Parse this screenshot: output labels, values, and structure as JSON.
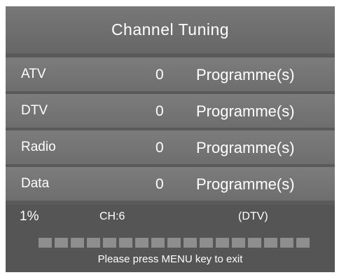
{
  "title": "Channel Tuning",
  "rows": [
    {
      "name": "ATV",
      "count": "0",
      "unit": "Programme(s)"
    },
    {
      "name": "DTV",
      "count": "0",
      "unit": "Programme(s)"
    },
    {
      "name": "Radio",
      "count": "0",
      "unit": "Programme(s)"
    },
    {
      "name": "Data",
      "count": "0",
      "unit": "Programme(s)"
    }
  ],
  "status": {
    "percent": "1%",
    "channel": "CH:6",
    "mode": "(DTV)",
    "progress_fraction": 0.01,
    "progress_segments": 17,
    "hint": "Please press MENU key to exit"
  }
}
